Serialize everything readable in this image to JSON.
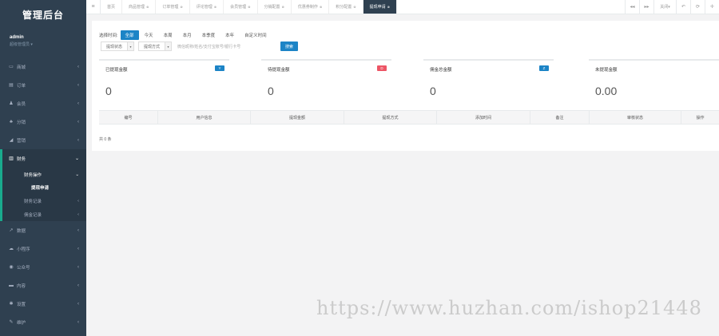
{
  "sidebar": {
    "brand": "管理后台",
    "user_name": "admin",
    "user_role": "超级管理员 ▾",
    "items_top": [
      {
        "icon": "▭",
        "label": "商城",
        "icon_name": "store-icon"
      },
      {
        "icon": "▤",
        "label": "订单",
        "icon_name": "order-icon"
      },
      {
        "icon": "♟",
        "label": "会员",
        "icon_name": "member-icon"
      },
      {
        "icon": "♣",
        "label": "分销",
        "icon_name": "distribution-icon"
      },
      {
        "icon": "◢",
        "label": "营销",
        "icon_name": "marketing-icon"
      }
    ],
    "finance": {
      "icon": "▥",
      "label": "财务",
      "icon_name": "finance-icon"
    },
    "finance_sub": {
      "open_label": "财务操作",
      "active_label": "提现申请",
      "record_label": "财务记录",
      "fund_label": "佣金记录"
    },
    "items_bottom": [
      {
        "icon": "↗",
        "label": "数据",
        "icon_name": "chart-icon"
      },
      {
        "icon": "☁",
        "label": "小程序",
        "icon_name": "miniprogram-icon"
      },
      {
        "icon": "◉",
        "label": "公众号",
        "icon_name": "wechat-icon"
      },
      {
        "icon": "▬",
        "label": "内容",
        "icon_name": "content-icon"
      },
      {
        "icon": "✱",
        "label": "设置",
        "icon_name": "settings-icon"
      },
      {
        "icon": "✎",
        "label": "维护",
        "icon_name": "maintenance-icon"
      }
    ]
  },
  "tabs": [
    {
      "label": "首页",
      "closable": false
    },
    {
      "label": "商品管理",
      "closable": true
    },
    {
      "label": "订单管理",
      "closable": true
    },
    {
      "label": "评论管理",
      "closable": true
    },
    {
      "label": "会员管理",
      "closable": true
    },
    {
      "label": "分销配置",
      "closable": true
    },
    {
      "label": "优惠券制作",
      "closable": true
    },
    {
      "label": "积分配置",
      "closable": true
    },
    {
      "label": "提现申请",
      "closable": true,
      "active": true
    }
  ],
  "topbar_right": {
    "prev": "◂◂",
    "next": "▸▸",
    "close_menu": "关闭▾",
    "back": "↶",
    "refresh": "⟳",
    "fullscreen": "✛"
  },
  "filter": {
    "time_label": "选择时间:",
    "time_options": [
      "全部",
      "今天",
      "本周",
      "本月",
      "本季度",
      "本年",
      "自定义时间"
    ],
    "status_select": "提现状态",
    "method_select": "提现方式",
    "search_placeholder": "微信昵称/姓名/支付宝账号/银行卡号",
    "search_button": "搜索"
  },
  "cards": [
    {
      "title": "已提现金额",
      "badge": "Y",
      "badge_color": "#1c84c6",
      "value": "0"
    },
    {
      "title": "待提现金额",
      "badge": "D",
      "badge_color": "#ed5565",
      "value": "0"
    },
    {
      "title": "佣金总金额",
      "badge": "Z",
      "badge_color": "#1c84c6",
      "value": "0"
    },
    {
      "title": "未提现金额",
      "badge": "",
      "badge_color": "#ffffff",
      "value": "0.00"
    }
  ],
  "table": {
    "columns": [
      "编号",
      "用户信息",
      "提现金额",
      "提现方式",
      "添加时间",
      "备注",
      "审核状态",
      "操作"
    ],
    "footer": "共 0 条"
  },
  "watermark": "https://www.huzhan.com/ishop21448",
  "colors": {
    "sidebar_bg": "#2f4050",
    "accent": "#1c84c6",
    "active_border": "#19aa8d",
    "danger": "#ed5565"
  }
}
